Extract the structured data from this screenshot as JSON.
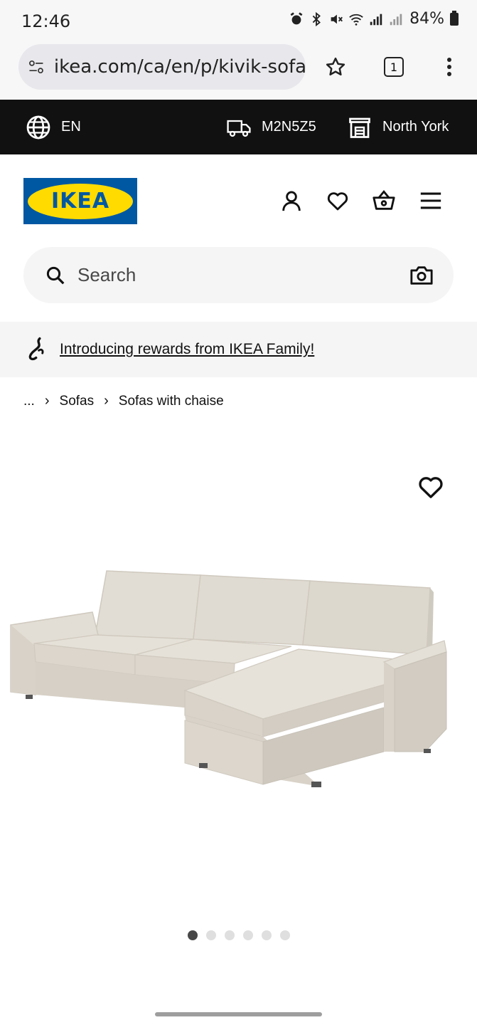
{
  "status": {
    "time": "12:46",
    "battery": "84%"
  },
  "browser": {
    "url": "ikea.com/ca/en/p/kivik-sofa-witl",
    "tab_count": "1"
  },
  "topbar": {
    "language": "EN",
    "postal_code": "M2N5Z5",
    "store": "North York"
  },
  "header": {
    "logo_text": "IKEA"
  },
  "search": {
    "placeholder": "Search"
  },
  "promo": {
    "text": "Introducing rewards from IKEA Family!"
  },
  "breadcrumb": {
    "ellipsis": "...",
    "items": [
      "Sofas",
      "Sofas with chaise"
    ]
  },
  "gallery": {
    "image_count": 6,
    "active_index": 0
  },
  "colors": {
    "ikea_blue": "#0058a3",
    "ikea_yellow": "#ffdb00",
    "sofa_fabric": "#ddd8ce",
    "topbar_bg": "#111111"
  }
}
